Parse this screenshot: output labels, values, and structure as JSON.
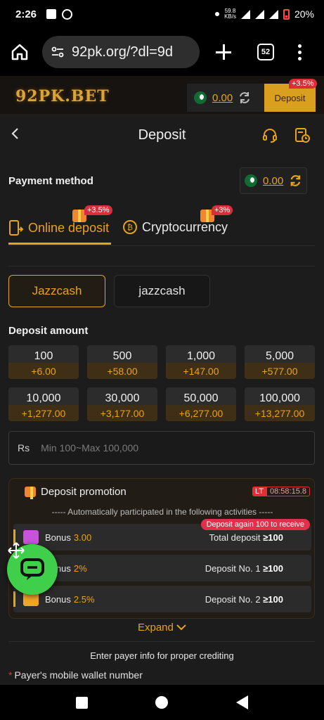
{
  "status_bar": {
    "time": "2:26",
    "speed_top": "59.8",
    "speed_bottom": "KB/s",
    "battery": "20%"
  },
  "browser": {
    "url": "92pk.org/?dl=9d",
    "tab_count": "52"
  },
  "site_header": {
    "logo": "92PK.BET",
    "balance": "0.00",
    "deposit_label": "Deposit",
    "deposit_badge": "+3.5%"
  },
  "page": {
    "title": "Deposit"
  },
  "payment_method": {
    "label": "Payment method",
    "balance": "0.00"
  },
  "tabs": [
    {
      "label": "Online deposit",
      "badge": "+3.5%"
    },
    {
      "label": "Cryptocurrency",
      "badge": "+3%"
    }
  ],
  "channels": [
    {
      "label": "Jazzcash"
    },
    {
      "label": "jazzcash"
    }
  ],
  "deposit_amount": {
    "label": "Deposit amount",
    "options": [
      {
        "value": "100",
        "bonus": "+6.00"
      },
      {
        "value": "500",
        "bonus": "+58.00"
      },
      {
        "value": "1,000",
        "bonus": "+147.00"
      },
      {
        "value": "5,000",
        "bonus": "+577.00"
      },
      {
        "value": "10,000",
        "bonus": "+1,277.00"
      },
      {
        "value": "30,000",
        "bonus": "+3,177.00"
      },
      {
        "value": "50,000",
        "bonus": "+6,277.00"
      },
      {
        "value": "100,000",
        "bonus": "+13,277.00"
      }
    ],
    "currency": "Rs",
    "placeholder": "Min 100~Max 100,000"
  },
  "promotion": {
    "title": "Deposit promotion",
    "lt_label": "LT",
    "timer": "08:58:15.8",
    "subtitle": "----- Automatically participated in the following activities -----",
    "again_tag": "Deposit again 100 to receive",
    "rows": [
      {
        "label": "Bonus",
        "value": "3.00",
        "condition": "Total deposit",
        "threshold": "≥100"
      },
      {
        "label": "Bonus",
        "value": "2%",
        "condition": "Deposit No. 1",
        "threshold": "≥100"
      },
      {
        "label": "Bonus",
        "value": "2.5%",
        "condition": "Deposit No. 2",
        "threshold": "≥100"
      }
    ],
    "expand_label": "Expand"
  },
  "payer": {
    "hint": "Enter payer info for proper crediting",
    "required_mark": "*",
    "label": "Payer's mobile wallet number"
  },
  "colors": {
    "accent": "#e8a317",
    "background": "#1c1c1c",
    "badge_red": "#d8303a",
    "chat_green": "#3fcf4a"
  },
  "icons": {
    "support": "headset-icon",
    "history": "history-icon",
    "refresh": "refresh-icon",
    "chat": "chat-icon"
  }
}
